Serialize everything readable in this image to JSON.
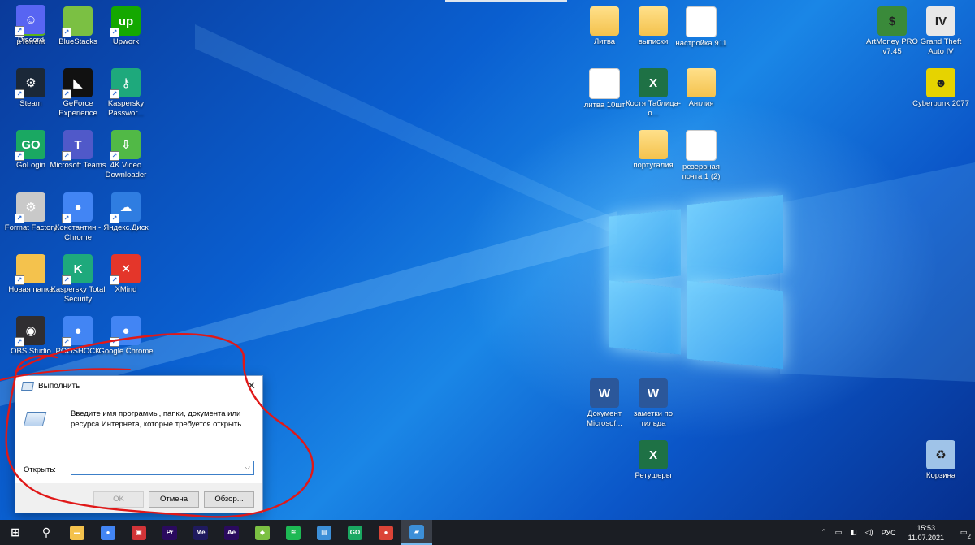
{
  "desktop": {
    "left_icons": [
      {
        "label": "µTorrent",
        "icon": "utorrent-icon",
        "color": "#5bb318",
        "glyph": "µ"
      },
      {
        "label": "BlueStacks",
        "icon": "bluestacks-icon",
        "color": "#7bc043",
        "glyph": ""
      },
      {
        "label": "Upwork",
        "icon": "upwork-icon",
        "color": "#14a800",
        "glyph": "up"
      },
      {
        "label": "Steam",
        "icon": "steam-icon",
        "color": "#1b2838",
        "glyph": "⚙"
      },
      {
        "label": "GeForce Experience",
        "icon": "geforce-icon",
        "color": "#111111",
        "glyph": "◣"
      },
      {
        "label": "Kaspersky Passwor...",
        "icon": "kaspersky-password-icon",
        "color": "#1ea97c",
        "glyph": "⚷"
      },
      {
        "label": "GoLogin",
        "icon": "gologin-icon",
        "color": "#1aa862",
        "glyph": "GO"
      },
      {
        "label": "Microsoft Teams",
        "icon": "teams-icon",
        "color": "#5059c9",
        "glyph": "T"
      },
      {
        "label": "4K Video Downloader",
        "icon": "4k-downloader-icon",
        "color": "#51b946",
        "glyph": "⇩"
      },
      {
        "label": "Format Factory",
        "icon": "format-factory-icon",
        "color": "#c9c9c9",
        "glyph": "⚙"
      },
      {
        "label": "Константин - Chrome",
        "icon": "chrome-icon",
        "color": "#4285f4",
        "glyph": "●"
      },
      {
        "label": "Яндекс.Диск",
        "icon": "yandex-disk-icon",
        "color": "#2f7de1",
        "glyph": "☁"
      },
      {
        "label": "Новая папка",
        "icon": "folder-icon",
        "color": "#f4c24d",
        "glyph": ""
      },
      {
        "label": "Kaspersky Total Security",
        "icon": "kaspersky-icon",
        "color": "#1ea97c",
        "glyph": "K"
      },
      {
        "label": "XMind",
        "icon": "xmind-icon",
        "color": "#e4362a",
        "glyph": "✕"
      },
      {
        "label": "OBS Studio",
        "icon": "obs-icon",
        "color": "#302e31",
        "glyph": "◉"
      },
      {
        "label": "POOSHOCK",
        "icon": "chrome-icon",
        "color": "#4285f4",
        "glyph": "●"
      },
      {
        "label": "Google Chrome",
        "icon": "chrome-icon",
        "color": "#4285f4",
        "glyph": "●"
      },
      {
        "label": "Discord",
        "icon": "discord-icon",
        "color": "#5865f2",
        "glyph": "☺"
      }
    ],
    "middle_icons": [
      {
        "label": "Литва",
        "type": "folder",
        "icon": "folder-icon"
      },
      {
        "label": "выписки",
        "type": "folder",
        "icon": "folder-icon"
      },
      {
        "label": "настройка 911",
        "type": "image",
        "icon": "image-file-icon"
      },
      {
        "label": "литва 10шт",
        "type": "doc",
        "icon": "text-file-icon"
      },
      {
        "label": "Костя Таблица-о...",
        "type": "xls",
        "icon": "excel-icon"
      },
      {
        "label": "Англия",
        "type": "folder",
        "icon": "folder-icon"
      },
      {
        "label": "португалия",
        "type": "folder",
        "icon": "folder-icon"
      },
      {
        "label": "резервная почта 1 (2)",
        "type": "doc",
        "icon": "text-file-icon"
      },
      {
        "label": "Документ Microsof...",
        "type": "wrd",
        "icon": "word-icon"
      },
      {
        "label": "заметки по тильда",
        "type": "wrd",
        "icon": "word-icon"
      },
      {
        "label": "Ретушеры",
        "type": "xls",
        "icon": "excel-icon"
      }
    ],
    "right_icons": [
      {
        "label": "ArtMoney PRO v7.45",
        "icon": "artmoney-icon",
        "color": "#3a8a3a",
        "glyph": "$"
      },
      {
        "label": "Grand Theft Auto IV",
        "icon": "gta-icon",
        "color": "#e8e8e8",
        "glyph": "IV"
      },
      {
        "label": "Cyberpunk 2077",
        "icon": "cyberpunk-icon",
        "color": "#e6d300",
        "glyph": "☻"
      },
      {
        "label": "Корзина",
        "icon": "recycle-bin-icon",
        "color": "#9fc3e8",
        "glyph": "♻"
      }
    ]
  },
  "run_dialog": {
    "title": "Выполнить",
    "close": "✕",
    "description": "Введите имя программы, папки, документа или ресурса Интернета, которые требуется открыть.",
    "open_label": "Открыть:",
    "open_value": "",
    "ok_label": "OK",
    "cancel_label": "Отмена",
    "browse_label": "Обзор..."
  },
  "taskbar": {
    "apps": [
      {
        "icon": "start-icon",
        "glyph": "⊞",
        "color": "transparent"
      },
      {
        "icon": "search-icon",
        "glyph": "⚲",
        "color": "transparent"
      },
      {
        "icon": "file-explorer-icon",
        "glyph": "▬",
        "color": "#f4c24d"
      },
      {
        "icon": "chrome-icon",
        "glyph": "●",
        "color": "#4285f4"
      },
      {
        "icon": "toolbox-icon",
        "glyph": "▣",
        "color": "#d13438"
      },
      {
        "icon": "premiere-pro-icon",
        "glyph": "Pr",
        "color": "#2a0a5e"
      },
      {
        "icon": "media-encoder-icon",
        "glyph": "Me",
        "color": "#1f1a5e"
      },
      {
        "icon": "after-effects-icon",
        "glyph": "Ae",
        "color": "#2a0a5e"
      },
      {
        "icon": "bluestacks-icon",
        "glyph": "◆",
        "color": "#7bc043"
      },
      {
        "icon": "spotify-icon",
        "glyph": "≋",
        "color": "#1db954"
      },
      {
        "icon": "control-panel-icon",
        "glyph": "▤",
        "color": "#3c8fd8"
      },
      {
        "icon": "gologin-icon",
        "glyph": "GO",
        "color": "#1aa862"
      },
      {
        "icon": "chrome-profile-icon",
        "glyph": "●",
        "color": "#db4437"
      },
      {
        "icon": "run-icon",
        "glyph": "▰",
        "color": "#3c8fd8"
      }
    ],
    "tray": {
      "chevron": "⌃",
      "language": "РУС",
      "time": "15:53",
      "date": "11.07.2021",
      "notifications": "2"
    }
  }
}
